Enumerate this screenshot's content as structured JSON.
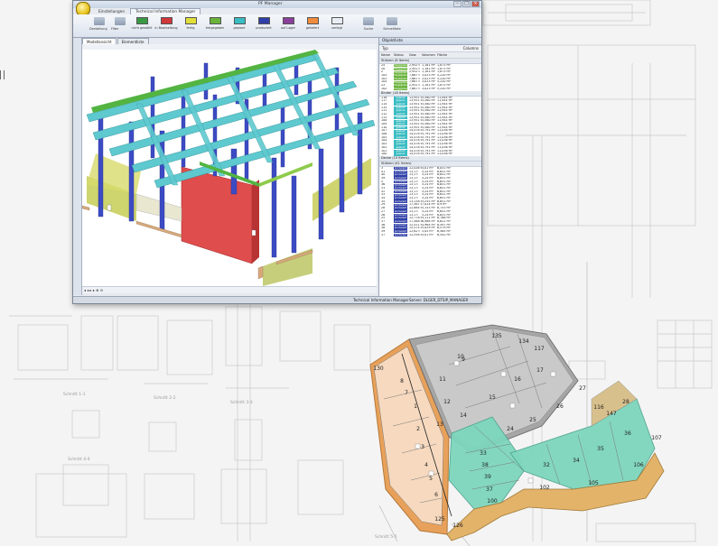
{
  "window": {
    "title": "PF Manager",
    "ribbon_tabs": [
      "Einstellungen",
      "Technical Information Manager"
    ],
    "status_buttons": [
      {
        "label": "nicht gewählt",
        "color": "#3a9a43"
      },
      {
        "label": "in Bearbeitung",
        "color": "#d0383a"
      },
      {
        "label": "fertig",
        "color": "#e1de3a"
      },
      {
        "label": "freigegeben",
        "color": "#69b33b"
      },
      {
        "label": "geplant",
        "color": "#39bcc2"
      },
      {
        "label": "produziert",
        "color": "#2f3fa7"
      },
      {
        "label": "auf Lager",
        "color": "#8a3f9a"
      },
      {
        "label": "geliefert",
        "color": "#f08c3c"
      },
      {
        "label": "verlegt",
        "color": "#e9eef5"
      }
    ],
    "left_buttons": [
      "Darstellung",
      "Filter"
    ],
    "right_buttons": [
      "Suche",
      "Schnellliste"
    ],
    "panel_tabs": [
      "Modellansicht",
      "Elementliste"
    ],
    "object_panel": {
      "title": "Objektliste",
      "toolbar_left": "Typ",
      "toolbar_right": "Columns",
      "columns": [
        "Name",
        "Status",
        "Gew.",
        "Volumen",
        "Fläche"
      ],
      "groups": [
        {
          "name": "Stützen (8 Items)",
          "color": "#69b33b",
          "status": "freigegeben",
          "rows": [
            [
              "25",
              "2,952 t",
              "1,181 m³",
              "1,873 m²"
            ],
            [
              "20",
              "2,952 t",
              "1,181 m³",
              "1,873 m²"
            ],
            [
              "2",
              "2,952 t",
              "1,181 m³",
              "1,873 m²"
            ],
            [
              "105",
              "7,667 t",
              "3,023 m³",
              "5,220 m²"
            ],
            [
              "103",
              "7,667 t",
              "3,023 m³",
              "5,220 m²"
            ],
            [
              "104",
              "7,667 t",
              "3,023 m³",
              "5,220 m²"
            ],
            [
              "23",
              "2,952 t",
              "1,181 m³",
              "1,873 m²"
            ],
            [
              "102",
              "7,667 t",
              "3,023 m³",
              "5,220 m²"
            ]
          ]
        },
        {
          "name": "Binder (18 Items)",
          "color": "#39bcc2",
          "status": "geplant",
          "rows": [
            [
              "116",
              "13,951 t",
              "5,580 m³",
              "11,944 m²"
            ],
            [
              "117",
              "13,951 t",
              "5,580 m³",
              "11,944 m²"
            ],
            [
              "114",
              "13,951 t",
              "5,580 m³",
              "11,944 m²"
            ],
            [
              "115",
              "13,951 t",
              "5,580 m³",
              "11,944 m²"
            ],
            [
              "111",
              "13,951 t",
              "5,580 m³",
              "11,944 m²"
            ],
            [
              "112",
              "13,951 t",
              "5,580 m³",
              "11,944 m²"
            ],
            [
              "113",
              "13,951 t",
              "5,580 m³",
              "11,944 m²"
            ],
            [
              "108",
              "13,951 t",
              "5,580 m³",
              "11,944 m²"
            ],
            [
              "109",
              "13,951 t",
              "5,580 m³",
              "11,944 m²"
            ],
            [
              "110",
              "13,951 t",
              "5,580 m³",
              "11,944 m²"
            ],
            [
              "107",
              "14,478 t",
              "5,791 m³",
              "11,036 m²"
            ],
            [
              "106",
              "14,478 t",
              "5,791 m³",
              "11,036 m²"
            ],
            [
              "105",
              "14,478 t",
              "5,791 m³",
              "11,036 m²"
            ],
            [
              "104",
              "14,478 t",
              "5,791 m³",
              "11,036 m²"
            ],
            [
              "103",
              "14,478 t",
              "5,791 m³",
              "11,036 m²"
            ],
            [
              "102",
              "14,478 t",
              "5,791 m³",
              "11,036 m²"
            ],
            [
              "101",
              "14,478 t",
              "5,791 m³",
              "11,036 m²"
            ],
            [
              "100",
              "14,478 t",
              "5,791 m³",
              "11,036 m²"
            ]
          ]
        },
        {
          "name": "Decke (10 Items)",
          "color": "#e1de3a",
          "status": "fertig",
          "rows": []
        },
        {
          "name": "Stützen (41 Items)",
          "color": "#2f3fa7",
          "status": "produziert",
          "rows": [
            [
              "3",
              "12,026 t",
              "5,01 m³",
              "6,051 m²"
            ],
            [
              "41",
              "13,1 t",
              "5,24 m³",
              "6,651 m²"
            ],
            [
              "40",
              "13,1 t",
              "5,24 m³",
              "6,651 m²"
            ],
            [
              "39",
              "13,1 t",
              "5,24 m³",
              "6,651 m²"
            ],
            [
              "5",
              "13,1 t",
              "5,24 m³",
              "6,651 m²"
            ],
            [
              "36",
              "13,1 t",
              "5,24 m³",
              "6,651 m²"
            ],
            [
              "31",
              "13,1 t",
              "5,24 m³",
              "6,651 m²"
            ],
            [
              "32",
              "13,1 t",
              "5,24 m³",
              "6,651 m²"
            ],
            [
              "33",
              "13,1 t",
              "5,24 m³",
              "6,651 m²"
            ],
            [
              "34",
              "13,1 t",
              "5,24 m³",
              "6,651 m²"
            ],
            [
              "35",
              "13,138 t",
              "5,255 m³",
              "6,651 m²"
            ],
            [
              "29",
              "17,567 t",
              "7,024 m³",
              "8,9 m²"
            ],
            [
              "28",
              "12,884 t",
              "5,153 m³",
              "6,753 m²"
            ],
            [
              "27",
              "13,1 t",
              "5,24 m³",
              "6,651 m²"
            ],
            [
              "26",
              "13,1 t",
              "5,24 m³",
              "6,651 m²"
            ],
            [
              "25",
              "12,778 t",
              "5,111 m³",
              "6,768 m²"
            ],
            [
              "37",
              "17,468 t",
              "6,988 m³",
              "8,621 m²"
            ],
            [
              "36",
              "12,411 t",
              "4,964 m³",
              "6,497 m²"
            ],
            [
              "38",
              "12,574 t",
              "5,029 m³",
              "6,579 m²"
            ],
            [
              "39",
              "12,62 t",
              "5,05 m³",
              "6,565 m²"
            ],
            [
              "37",
              "12,558 t",
              "5,01 m³",
              "6,542 m²"
            ]
          ]
        }
      ]
    },
    "statusbar": {
      "left": "Technical Information Manager",
      "right": "Server: DLGER_DTSIP_MANAGER"
    }
  },
  "plan_labels": [
    "135",
    "134",
    "130",
    "117",
    "10",
    "11",
    "12",
    "13",
    "14",
    "9",
    "17",
    "16",
    "15",
    "25",
    "26",
    "27",
    "28",
    "29",
    "30",
    "31",
    "32",
    "33",
    "34",
    "35",
    "36",
    "37",
    "38",
    "39",
    "100",
    "101",
    "102",
    "103",
    "104",
    "105",
    "106",
    "107",
    "125",
    "126",
    "1",
    "2",
    "3",
    "4",
    "5",
    "6",
    "7",
    "8",
    "24",
    "116",
    "147"
  ],
  "drawing_labels": [
    "Schnitt 1-1",
    "Schnitt 2-2",
    "Schnitt 3-3",
    "Schnitt 4-4",
    "Schnitt 5-5"
  ]
}
